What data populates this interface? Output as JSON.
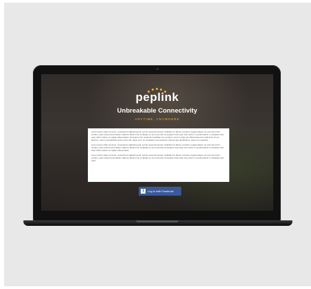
{
  "brand": {
    "name": "peplink",
    "accent_color": "#f2b233"
  },
  "hero": {
    "title": "Unbreakable Connectivity",
    "subtitle": "ANYTIME, ANYWHERE"
  },
  "terms": {
    "paragraphs": [
      "Lorem ipsum dolor sit amet, consectetur adipiscing elit, sed do eiusmod tempor incididunt ut labore et dolore magna aliqua. Ut enim ad minim veniam, quis nostrud exercitation ullamco laboris nisi ut aliquip ex ea commodo consequat. Duis aute irure dolor in reprehenderit in voluptate velit esse cillum dolore eu fugiat nulla pariatur. Excepteur sint occaecat cupidatat non proident, sunt in culpa qui officia deserunt mollit anim id est laborum. Sed ut perspiciatis unde omnis iste natus error sit voluptatem accusantium doloremque laudantium, totam rem aperiam.",
      "Lorem ipsum dolor sit amet, consectetur adipiscing elit, sed do eiusmod tempor incididunt ut labore et dolore magna aliqua. Ut enim ad minim veniam, quis nostrud exercitation ullamco laboris nisi ut aliquip ex ea commodo consequat. Duis aute irure dolor in reprehenderit in voluptate velit esse cillum dolore eu fugiat nulla pariatur.",
      "Lorem ipsum dolor sit amet, consectetur adipiscing elit, sed do eiusmod tempor incididunt ut labore et dolore magna aliqua. Ut enim ad minim veniam, quis nostrud exercitation ullamco laboris nisi ut aliquip ex ea commodo consequat. Duis aute irure dolor in reprehenderit in voluptate velit esse."
    ]
  },
  "login": {
    "facebook_label": "Log in with Facebook",
    "facebook_icon": "facebook-icon",
    "facebook_color": "#3b5998"
  }
}
